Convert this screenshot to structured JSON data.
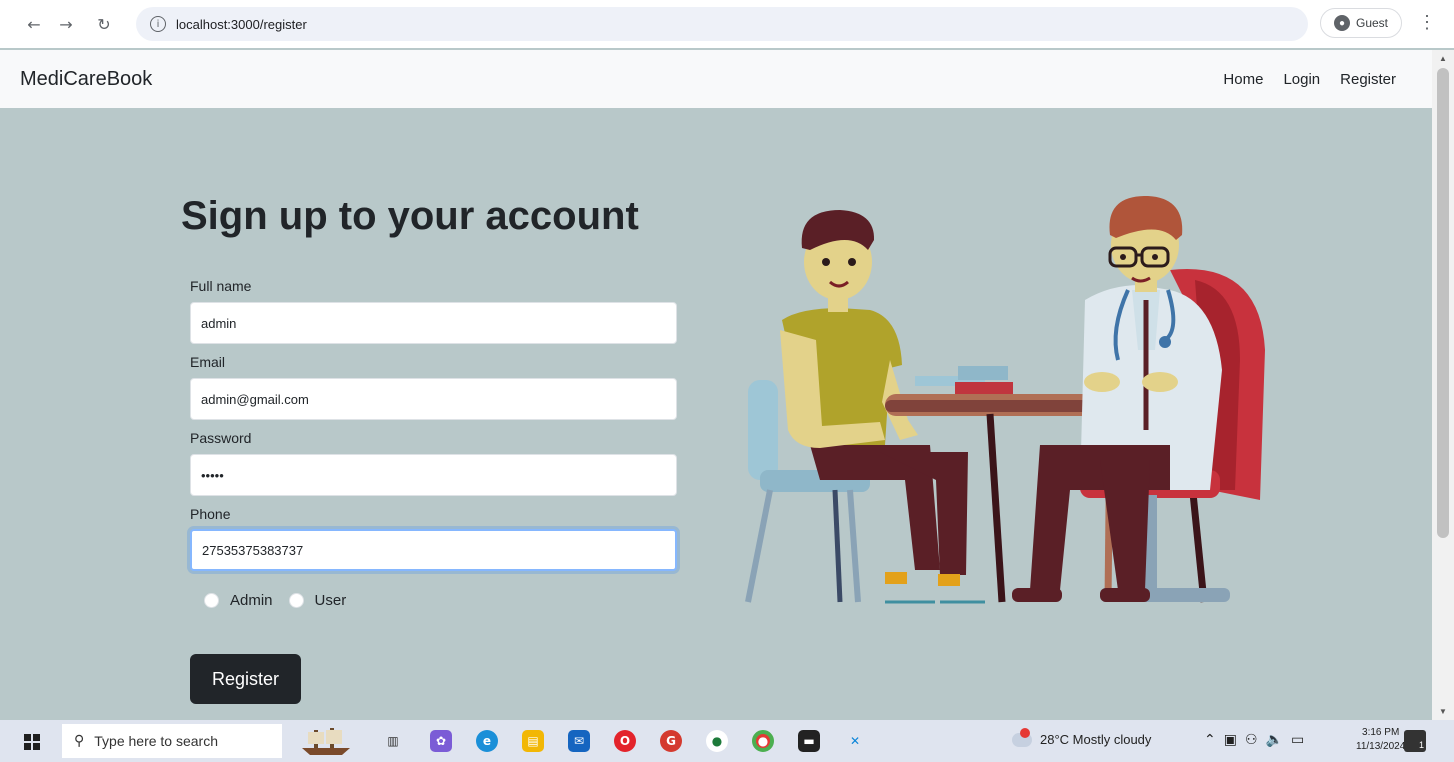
{
  "browser": {
    "url": "localhost:3000/register",
    "profile_label": "Guest"
  },
  "navbar": {
    "brand": "MediCareBook",
    "links": [
      "Home",
      "Login",
      "Register"
    ]
  },
  "form": {
    "title": "Sign up to your account",
    "full_name": {
      "label": "Full name",
      "value": "admin"
    },
    "email": {
      "label": "Email",
      "value": "admin@gmail.com"
    },
    "password": {
      "label": "Password",
      "value": "•••••"
    },
    "phone": {
      "label": "Phone",
      "value": "27535375383737"
    },
    "roles": [
      "Admin",
      "User"
    ],
    "submit_label": "Register"
  },
  "taskbar": {
    "search_placeholder": "Type here to search",
    "weather": "28°C  Mostly cloudy",
    "time": "3:16 PM",
    "date": "11/13/2024",
    "notification_count": "1"
  },
  "colors": {
    "page_bg": "#b8c8c9",
    "button_bg": "#212529",
    "navbar_bg": "#f8f9fa"
  }
}
